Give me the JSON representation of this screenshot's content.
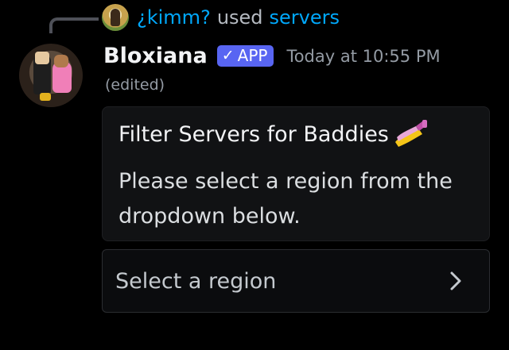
{
  "reply": {
    "user": "¿kimm?",
    "used": "used",
    "command": "servers"
  },
  "message": {
    "author": "Bloxiana",
    "badge": "APP",
    "timestamp": "Today at 10:55 PM",
    "edited": "(edited)"
  },
  "embed": {
    "title": "Filter Servers for Baddies",
    "title_icon": "nail-polish-icon",
    "description": "Please select a region from the dropdown below."
  },
  "select": {
    "placeholder": "Select a region",
    "icon": "chevron-right-icon"
  },
  "colors": {
    "link": "#00a8fc",
    "badge": "#5865f2",
    "background": "#000000",
    "embed_bg": "#111214"
  }
}
